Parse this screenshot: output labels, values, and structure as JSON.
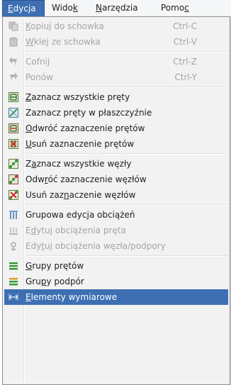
{
  "menubar": {
    "items": [
      {
        "pre": "",
        "u": "E",
        "post": "dycja"
      },
      {
        "pre": "Wido",
        "u": "k",
        "post": ""
      },
      {
        "pre": "",
        "u": "N",
        "post": "arzędzia"
      },
      {
        "pre": "Pomo",
        "u": "c",
        "post": ""
      }
    ]
  },
  "menu": {
    "copy": {
      "pre": "",
      "u": "K",
      "post": "opiuj do schowka",
      "shortcut": "Ctrl-C",
      "icon": "copy-icon",
      "enabled": false
    },
    "paste": {
      "pre": "",
      "u": "W",
      "post": "klej ze schowka",
      "shortcut": "Ctrl-V",
      "icon": "paste-icon",
      "enabled": false
    },
    "undo": {
      "pre": "Cofnij",
      "u": "",
      "post": "",
      "shortcut": "Ctrl-Z",
      "icon": "undo-icon",
      "enabled": false
    },
    "redo": {
      "pre": "Ponów",
      "u": "",
      "post": "",
      "shortcut": "Ctrl-Y",
      "icon": "redo-icon",
      "enabled": false
    },
    "sel_all_bars": {
      "pre": "",
      "u": "Z",
      "post": "aznacz wszystkie pręty",
      "icon": "select-all-bars-icon"
    },
    "sel_bars_plane": {
      "pre": "Zaznacz pręty w płaszczyźnie",
      "u": "",
      "post": "",
      "icon": "select-bars-plane-icon"
    },
    "inv_bars": {
      "pre": "",
      "u": "O",
      "post": "dwróć zaznaczenie prętów",
      "icon": "invert-bars-icon"
    },
    "clr_bars": {
      "pre": "",
      "u": "U",
      "post": "suń zaznaczenie prętów",
      "icon": "clear-bars-icon"
    },
    "sel_all_nodes": {
      "pre": "Z",
      "u": "a",
      "post": "znacz wszystkie węzły",
      "icon": "select-all-nodes-icon"
    },
    "inv_nodes": {
      "pre": "Odw",
      "u": "r",
      "post": "óć zaznaczenie węzłów",
      "icon": "invert-nodes-icon"
    },
    "clr_nodes": {
      "pre": "Usuń zaz",
      "u": "n",
      "post": "aczenie węzłów",
      "icon": "clear-nodes-icon"
    },
    "group_loads": {
      "pre": "Grupowa edycja obciążeń",
      "u": "",
      "post": "",
      "icon": "group-loads-icon",
      "enabled": true
    },
    "edit_bar_loads": {
      "pre": "E",
      "u": "d",
      "post": "ytuj obciążenia pręta",
      "icon": "bar-loads-icon",
      "enabled": false
    },
    "edit_node_loads": {
      "pre": "Edy",
      "u": "t",
      "post": "uj obciążenia węzła/podpory",
      "icon": "node-loads-icon",
      "enabled": false
    },
    "bar_groups": {
      "pre": "",
      "u": "G",
      "post": "rupy prętów",
      "icon": "bar-groups-icon"
    },
    "support_groups": {
      "pre": "Gru",
      "u": "p",
      "post": "y podpór",
      "icon": "support-groups-icon"
    },
    "dimensions": {
      "pre": "",
      "u": "E",
      "post": "lementy wymiarowe",
      "icon": "dimension-elements-icon"
    }
  },
  "colors": {
    "highlight": "#3d6fb2",
    "disabled_text": "#a5a5a5",
    "menu_bg": "#f2f2f2",
    "icon_green": "#2e9b2e",
    "icon_red": "#c0392b"
  }
}
